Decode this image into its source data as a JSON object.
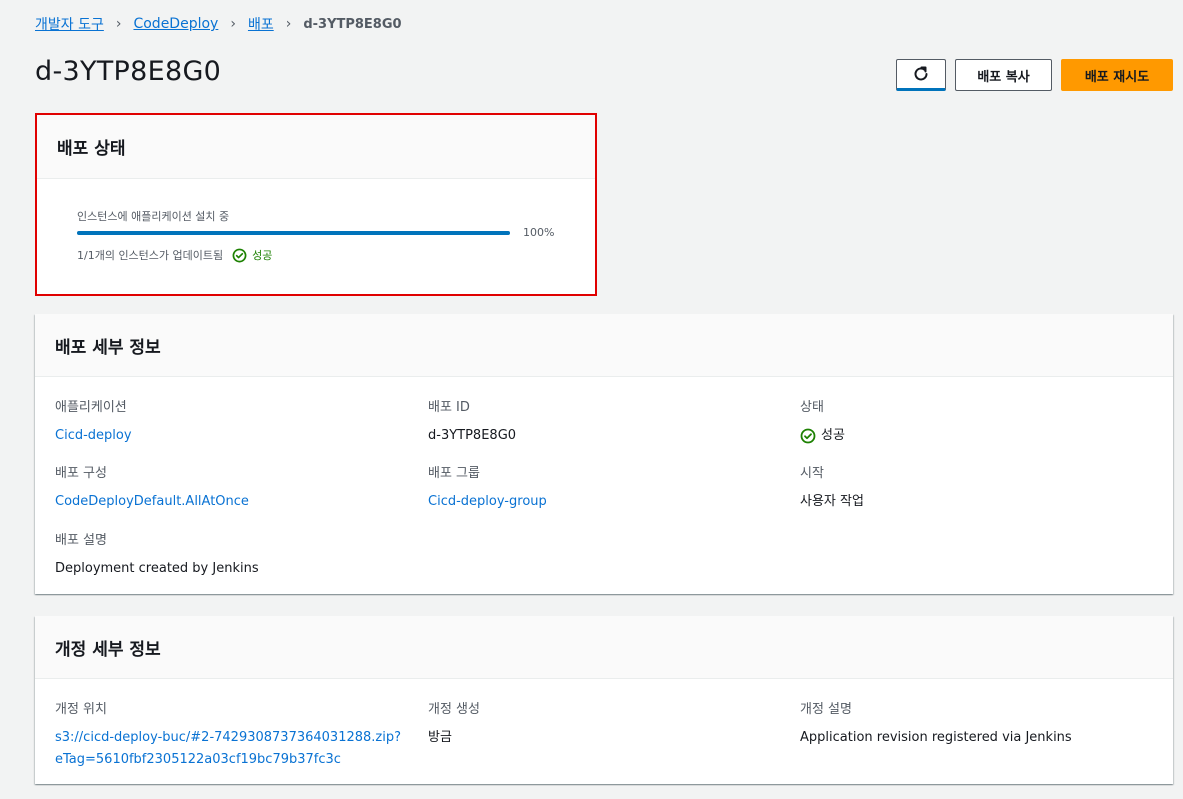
{
  "breadcrumb": {
    "items": [
      "개발자 도구",
      "CodeDeploy",
      "배포"
    ],
    "current": "d-3YTP8E8G0"
  },
  "page": {
    "title": "d-3YTP8E8G0"
  },
  "actions": {
    "refresh_icon": "refresh-icon",
    "copy_label": "배포 복사",
    "retry_label": "배포 재시도",
    "retry_color": "#ff9900"
  },
  "status": {
    "title": "배포 상태",
    "progress_label": "인스턴스에 애플리케이션 설치 중",
    "progress_value": 100,
    "progress_text": "100%",
    "instances_text": "1/1개의 인스턴스가 업데이트됨",
    "result": "성공",
    "success_color": "#1d8102"
  },
  "details": {
    "title": "배포 세부 정보",
    "application_label": "애플리케이션",
    "application_value": "Cicd-deploy",
    "deployment_id_label": "배포 ID",
    "deployment_id_value": "d-3YTP8E8G0",
    "state_label": "상태",
    "state_value": "성공",
    "config_label": "배포 구성",
    "config_value": "CodeDeployDefault.AllAtOnce",
    "group_label": "배포 그룹",
    "group_value": "Cicd-deploy-group",
    "start_label": "시작",
    "start_value": "사용자 작업",
    "description_label": "배포 설명",
    "description_value": "Deployment created by Jenkins"
  },
  "revision": {
    "title": "개정 세부 정보",
    "location_label": "개정 위치",
    "location_line1": "s3://cicd-deploy-buc/#2-7429308737364031288.zip?",
    "location_line2": "eTag=5610fbf2305122a03cf19bc79b37fc3c",
    "created_label": "개정 생성",
    "created_value": "방금",
    "description_label": "개정 설명",
    "description_value": "Application revision registered via Jenkins"
  }
}
